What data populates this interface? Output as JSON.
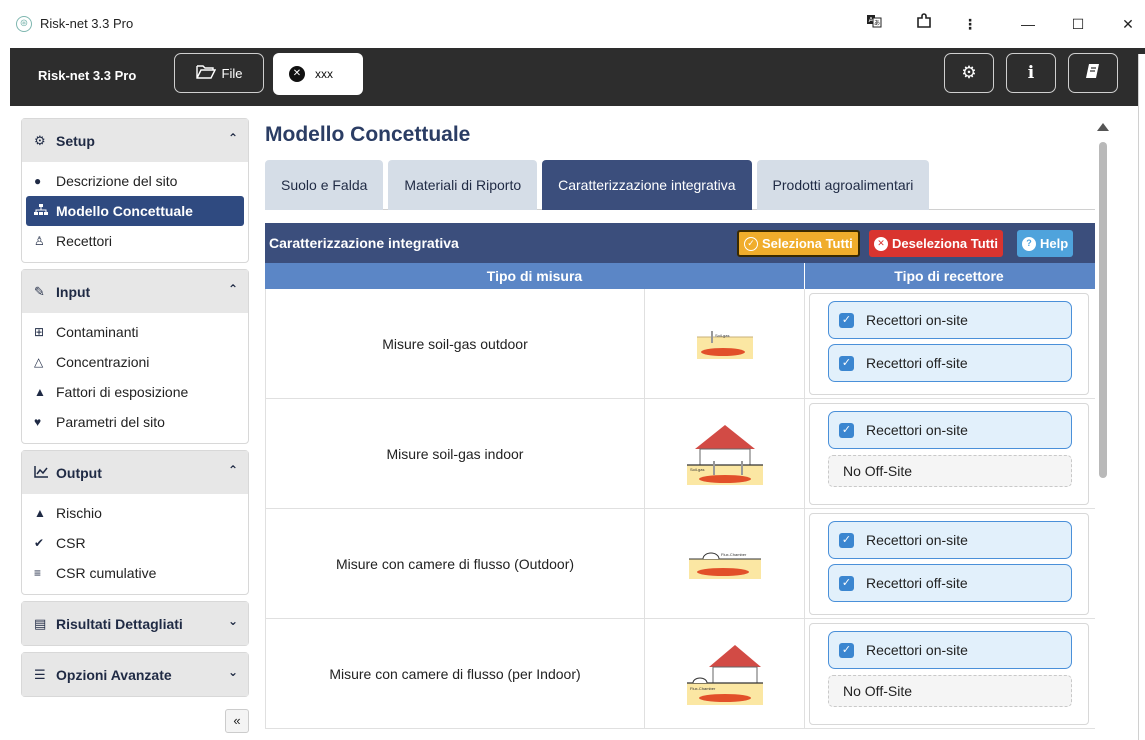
{
  "window": {
    "title": "Risk-net 3.3 Pro",
    "controls": {
      "minimize": "—",
      "maximize": "☐",
      "close": "✕"
    }
  },
  "appbar": {
    "app_name": "Risk-net 3.3 Pro",
    "file_label": "File",
    "open_tab_label": "xxx"
  },
  "sidebar": {
    "setup": {
      "title": "Setup",
      "items": [
        {
          "label": "Descrizione del sito",
          "icon": "info-circle-icon"
        },
        {
          "label": "Modello Concettuale",
          "icon": "sitemap-icon",
          "active": true
        },
        {
          "label": "Recettori",
          "icon": "person-icon"
        }
      ]
    },
    "input": {
      "title": "Input",
      "items": [
        {
          "label": "Contaminanti",
          "icon": "plus-square-icon"
        },
        {
          "label": "Concentrazioni",
          "icon": "flask-icon"
        },
        {
          "label": "Fattori di esposizione",
          "icon": "user-icon"
        },
        {
          "label": "Parametri del sito",
          "icon": "map-marker-icon"
        }
      ]
    },
    "output": {
      "title": "Output",
      "items": [
        {
          "label": "Rischio",
          "icon": "warning-icon"
        },
        {
          "label": "CSR",
          "icon": "check-circle-icon"
        },
        {
          "label": "CSR cumulative",
          "icon": "bars-icon"
        }
      ]
    },
    "risultati": {
      "title": "Risultati Dettagliati"
    },
    "opzioni": {
      "title": "Opzioni Avanzate"
    }
  },
  "main": {
    "title": "Modello Concettuale",
    "tabs": [
      {
        "label": "Suolo e Falda"
      },
      {
        "label": "Materiali di Riporto"
      },
      {
        "label": "Caratterizzazione integrativa",
        "active": true
      },
      {
        "label": "Prodotti agroalimentari"
      }
    ],
    "panel": {
      "title": "Caratterizzazione integrativa",
      "select_all": "Seleziona Tutti",
      "deselect_all": "Deseleziona Tutti",
      "help": "Help"
    },
    "columns": {
      "measure_type": "Tipo di misura",
      "receptor_type": "Tipo di recettore"
    },
    "rows": [
      {
        "label": "Misure soil-gas outdoor",
        "diagram_label": "Soil-gas",
        "onsite": "Recettori on-site",
        "offsite": "Recettori off-site"
      },
      {
        "label": "Misure soil-gas indoor",
        "diagram_label": "Soil-gas",
        "onsite": "Recettori on-site",
        "no_offsite": "No Off-Site"
      },
      {
        "label": "Misure con camere di flusso (Outdoor)",
        "diagram_label": "Flux-Chamber",
        "onsite": "Recettori on-site",
        "offsite": "Recettori off-site"
      },
      {
        "label": "Misure con camere di flusso (per Indoor)",
        "diagram_label": "Flux-Chamber",
        "onsite": "Recettori on-site",
        "no_offsite": "No Off-Site"
      }
    ]
  },
  "colors": {
    "appbar": "#2d2d2d",
    "accent_navy": "#3b4e7c",
    "column_header": "#5b86c6",
    "select_all": "#f0ad2c",
    "deselect_all": "#d9342f",
    "help": "#4fa3dc",
    "chip_bg": "#e2f0fb"
  }
}
